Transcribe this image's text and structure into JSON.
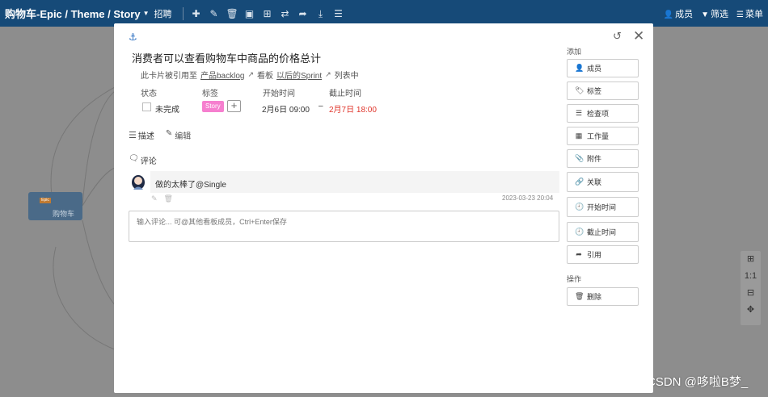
{
  "topbar": {
    "breadcrumb": "购物车-Epic / Theme / Story",
    "breadcrumb_sub": "招聘",
    "members_label": "成员",
    "filter_label": "筛选",
    "menu_label": "菜单"
  },
  "canvas": {
    "node_tag": "Epic",
    "node_title": "购物车",
    "zoom_ratio": "1:1"
  },
  "watermark": "CSDN @哆啦B梦_",
  "card": {
    "title": "消费者可以查看购物车中商品的价格总计",
    "ref_prefix": "此卡片被引用至",
    "ref_board": "产品backlog",
    "ref_board_suffix": "看板",
    "ref_list": "以后的Sprint",
    "ref_list_suffix": "列表中",
    "status_head": "状态",
    "tags_head": "标签",
    "start_head": "开始时间",
    "end_head": "截止时间",
    "status_value": "未完成",
    "tag_story": "Story",
    "start_value": "2月6日 09:00",
    "dash": "–",
    "end_value": "2月7日 18:00",
    "desc_label": "描述",
    "edit_label": "编辑",
    "comments_label": "评论",
    "comment_text": "做的太棒了@Single",
    "comment_date": "2023-03-23 20:04",
    "comment_placeholder": "输入评论... 可@其他看板成员，Ctrl+Enter保存"
  },
  "sidebar": {
    "add_label": "添加",
    "members": "成员",
    "tags": "标签",
    "checklist": "检查项",
    "workload": "工作量",
    "attachment": "附件",
    "relation": "关联",
    "start_time": "开始时间",
    "end_time": "截止时间",
    "reference": "引用",
    "actions_label": "操作",
    "delete": "删除"
  },
  "colors": {
    "topbar": "#164a78",
    "story_badge": "#f67fcf",
    "overdue": "#e0352b"
  }
}
